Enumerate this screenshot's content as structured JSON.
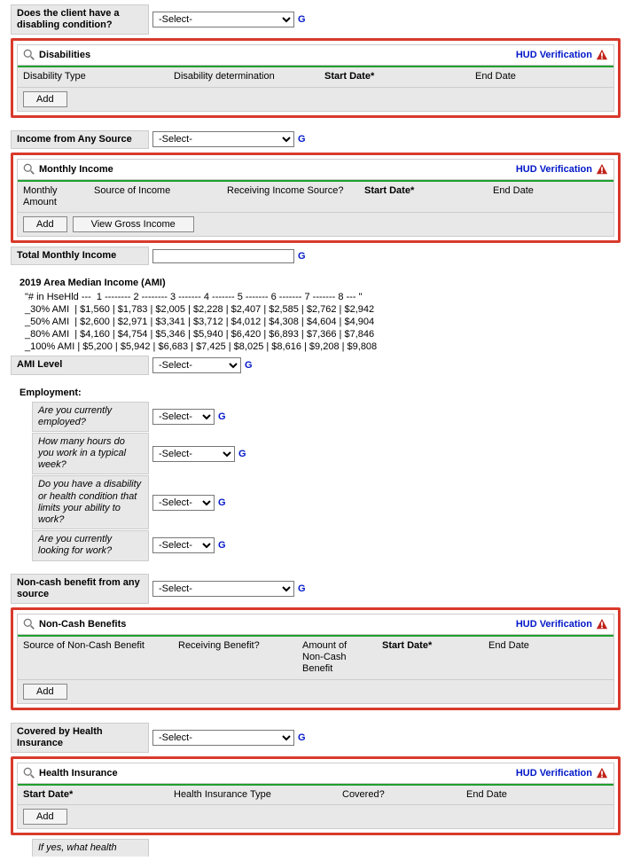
{
  "g_label": "G",
  "select_placeholder": "-Select-",
  "hud_verification_label": "HUD Verification",
  "add_label": "Add",
  "view_gross_label": "View Gross Income",
  "disabling_q": "Does the client have a disabling condition?",
  "disabilities": {
    "title": "Disabilities",
    "cols": [
      "Disability Type",
      "Disability determination",
      "Start Date*",
      "End Date"
    ]
  },
  "income_any_source_label": "Income from Any Source",
  "monthly_income": {
    "title": "Monthly Income",
    "cols": [
      "Monthly Amount",
      "Source of Income",
      "Receiving Income Source?",
      "Start Date*",
      "End Date"
    ]
  },
  "total_monthly_label": "Total Monthly Income",
  "ami": {
    "heading": "2019 Area Median Income (AMI)",
    "header_line": "\"# in HseHld ---  1 -------- 2 -------- 3 ------- 4 ------- 5 ------- 6 ------- 7 ------- 8 --- \"",
    "rows": [
      "_30% AMI  | $1,560 | $1,783 | $2,005 | $2,228 | $2,407 | $2,585 | $2,762 | $2,942",
      "_50% AMI  | $2,600 | $2,971 | $3,341 | $3,712 | $4,012 | $4,308 | $4,604 | $4,904",
      "_80% AMI  | $4,160 | $4,754 | $5,346 | $5,940 | $6,420 | $6,893 | $7,366 | $7,846",
      "_100% AMI | $5,200 | $5,942 | $6,683 | $7,425 | $8,025 | $8,616 | $9,208 | $9,808"
    ],
    "level_label": "AMI Level"
  },
  "employment": {
    "heading": "Employment:",
    "q1": "Are you currently employed?",
    "q2": "How many hours do you work in a typical week?",
    "q3": "Do you have a disability or health condition that limits your ability to work?",
    "q4": "Are you currently looking for work?"
  },
  "noncash_label": "Non-cash benefit from any source",
  "noncash": {
    "title": "Non-Cash Benefits",
    "cols": [
      "Source of Non-Cash Benefit",
      "Receiving Benefit?",
      "Amount of Non-Cash Benefit",
      "Start Date*",
      "End Date"
    ]
  },
  "covered_hi_label": "Covered by Health Insurance",
  "hi": {
    "title": "Health Insurance",
    "cols": [
      "Start Date*",
      "Health Insurance Type",
      "Covered?",
      "End Date"
    ]
  },
  "footer_q": "If yes, what health"
}
